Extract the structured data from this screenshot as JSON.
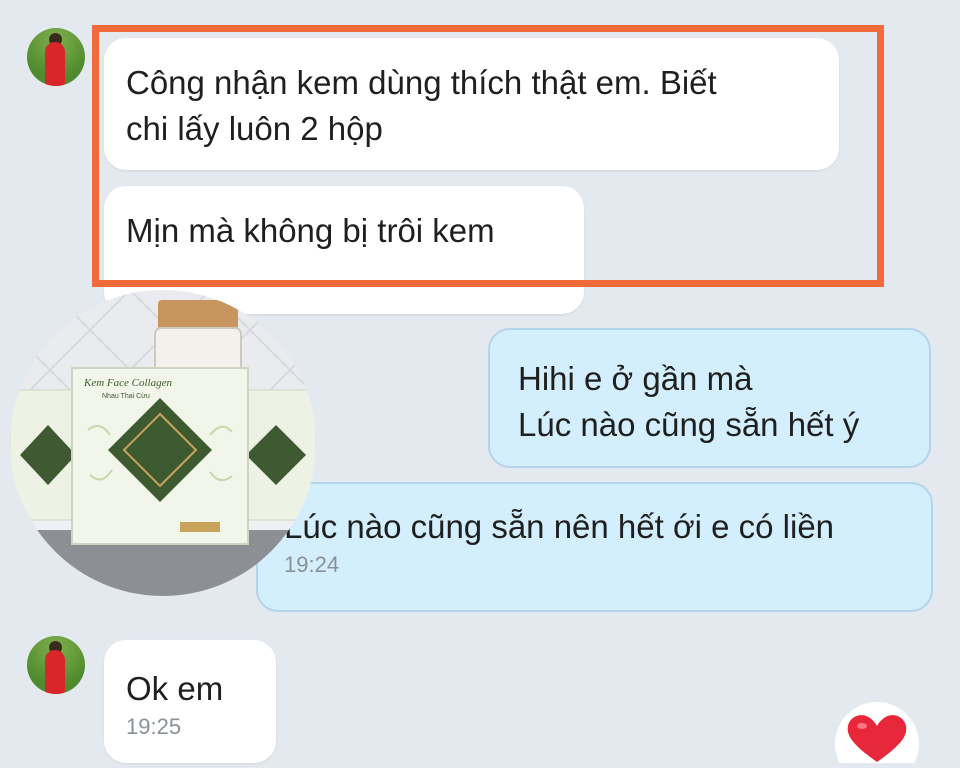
{
  "chat": {
    "incoming_1": {
      "lines": [
        "Công nhận kem dùng thích thật em. Biết",
        "chi lấy luôn 2 hộp"
      ]
    },
    "incoming_2": {
      "text": "Mịn mà không bị trôi kem"
    },
    "outgoing_1": {
      "lines": [
        "Hihi e ở gần mà",
        "Lúc nào cũng sẵn hết ý"
      ]
    },
    "outgoing_2": {
      "text": "Lúc nào cũng sẵn nên hết ới e có liền",
      "time": "19:24"
    },
    "incoming_3": {
      "text": "Ok em",
      "time": "19:25"
    }
  },
  "product_image": {
    "box_labels": [
      "Kem Face Collagen",
      "Nhau Thai Cừu"
    ]
  },
  "reaction": {
    "icon": "heart-icon"
  },
  "colors": {
    "background": "#e4e8ef",
    "incoming_bubble": "#ffffff",
    "outgoing_bubble": "#d3eefc",
    "highlight_border": "#f06a3a",
    "heart": "#e8283a"
  }
}
